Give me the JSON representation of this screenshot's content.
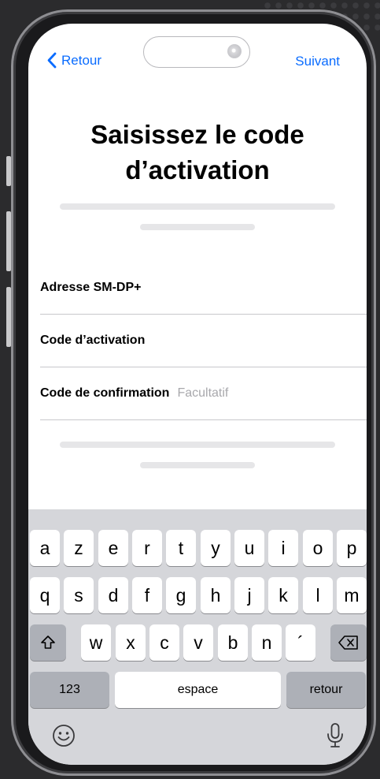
{
  "nav": {
    "back_label": "Retour",
    "next_label": "Suivant"
  },
  "title": {
    "line1": "Saisissez le code",
    "line2": "d’activation"
  },
  "fields": [
    {
      "label": "Adresse SM-DP+",
      "value": "",
      "placeholder": ""
    },
    {
      "label": "Code d’activation",
      "value": "",
      "placeholder": ""
    },
    {
      "label": "Code de confirmation",
      "value": "",
      "placeholder": "Facultatif"
    }
  ],
  "keyboard": {
    "row1": [
      "a",
      "z",
      "e",
      "r",
      "t",
      "y",
      "u",
      "i",
      "o",
      "p"
    ],
    "row2": [
      "q",
      "s",
      "d",
      "f",
      "g",
      "h",
      "j",
      "k",
      "l",
      "m"
    ],
    "row3": [
      "w",
      "x",
      "c",
      "v",
      "b",
      "n",
      "´"
    ],
    "numbers_label": "123",
    "space_label": "espace",
    "return_label": "retour",
    "icons": {
      "shift": "shift-icon",
      "delete": "delete-icon",
      "emoji": "emoji-icon",
      "dictation": "microphone-icon"
    }
  },
  "colors": {
    "accent": "#0a6cff",
    "background": "#2b2b2d",
    "keyboard": "#d5d6da"
  }
}
